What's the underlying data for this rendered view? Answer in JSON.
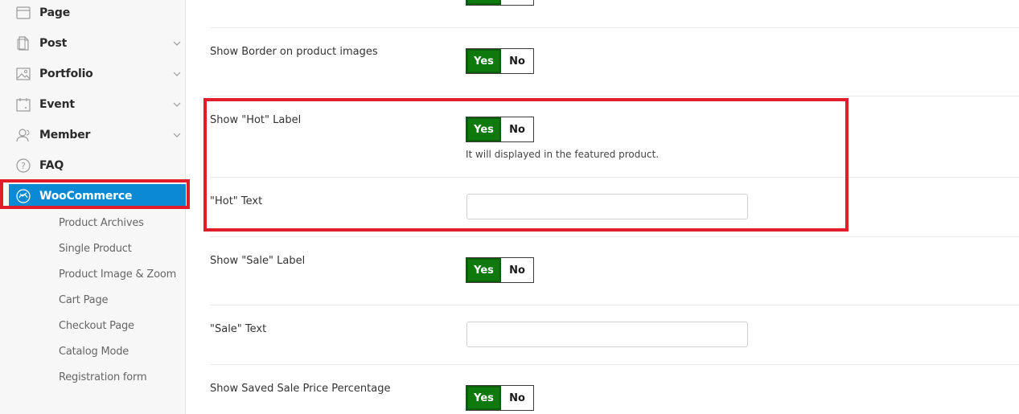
{
  "sidebar": {
    "items": [
      {
        "label": "Page",
        "icon": "page-icon"
      },
      {
        "label": "Post",
        "icon": "post-icon"
      },
      {
        "label": "Portfolio",
        "icon": "portfolio-icon"
      },
      {
        "label": "Event",
        "icon": "event-icon"
      },
      {
        "label": "Member",
        "icon": "member-icon"
      },
      {
        "label": "FAQ",
        "icon": "faq-icon"
      },
      {
        "label": "WooCommerce",
        "icon": "woocommerce-icon"
      }
    ],
    "subitems": [
      "Product Archives",
      "Single Product",
      "Product Image & Zoom",
      "Cart Page",
      "Checkout Page",
      "Catalog Mode",
      "Registration form"
    ]
  },
  "toggle": {
    "yes": "Yes",
    "no": "No"
  },
  "settings": {
    "show_border": {
      "label": "Show Border on product images"
    },
    "show_hot": {
      "label": "Show \"Hot\" Label",
      "hint": "It will displayed in the featured product."
    },
    "hot_text": {
      "label": "\"Hot\" Text",
      "value": ""
    },
    "show_sale": {
      "label": "Show \"Sale\" Label"
    },
    "sale_text": {
      "label": "\"Sale\" Text",
      "value": ""
    },
    "show_saved": {
      "label": "Show Saved Sale Price Percentage"
    }
  },
  "colors": {
    "accent": "#0b8ad3",
    "yes_bg": "#0e7a0d",
    "annotation": "#e11d2b"
  }
}
